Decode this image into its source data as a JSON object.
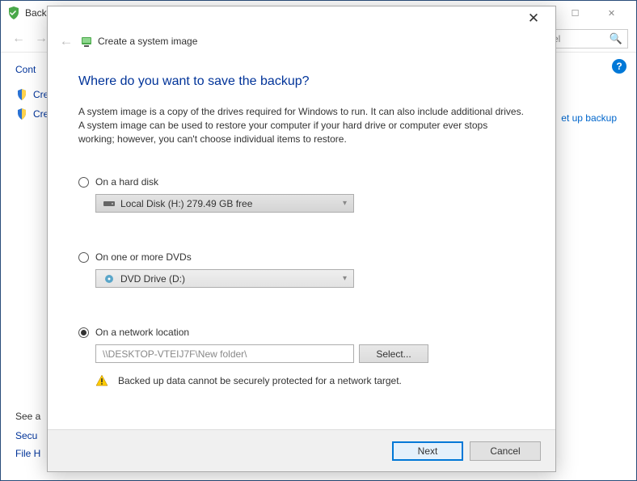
{
  "bg": {
    "title": "Back",
    "heading": "Cont",
    "links": {
      "create1": "Creat",
      "create2": "Creat"
    },
    "setup_link": "et up backup",
    "search_placeholder": "el",
    "seealso": {
      "heading": "See a",
      "security": "Secu",
      "filehistory": "File H"
    }
  },
  "modal": {
    "title": "Create a system image",
    "heading": "Where do you want to save the backup?",
    "description": "A system image is a copy of the drives required for Windows to run. It can also include additional drives. A system image can be used to restore your computer if your hard drive or computer ever stops working; however, you can't choose individual items to restore.",
    "options": {
      "harddisk": {
        "label": "On a hard disk",
        "value": "Local Disk (H:)  279.49 GB free",
        "checked": false
      },
      "dvd": {
        "label": "On one or more DVDs",
        "value": "DVD Drive (D:)",
        "checked": false
      },
      "network": {
        "label": "On a network location",
        "value": "\\\\DESKTOP-VTEIJ7F\\New folder\\",
        "checked": true,
        "select_btn": "Select...",
        "warning": "Backed up data cannot be securely protected for a network target."
      }
    },
    "buttons": {
      "next": "Next",
      "cancel": "Cancel"
    }
  }
}
